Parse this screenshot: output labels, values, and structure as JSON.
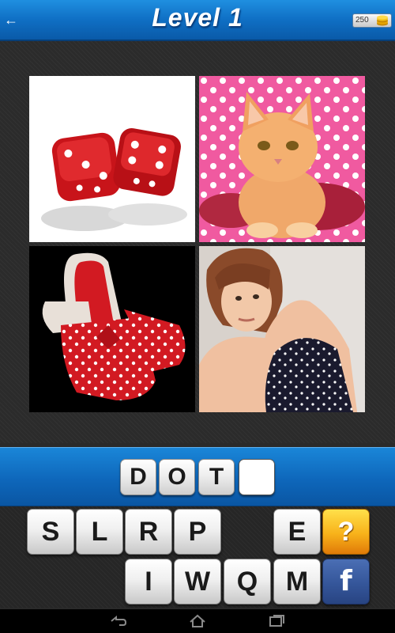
{
  "header": {
    "title": "Level 1",
    "back_icon": "back-arrow-icon",
    "coins": "250",
    "coin_icon": "coin-stack-icon"
  },
  "photos": [
    {
      "subject": "red dice"
    },
    {
      "subject": "orange kitten on pink polka-dot background"
    },
    {
      "subject": "red polka-dot slippers"
    },
    {
      "subject": "woman in polka-dot dress"
    }
  ],
  "answer": {
    "letters": [
      "D",
      "O",
      "T",
      ""
    ]
  },
  "keyboard": {
    "row1": [
      "S",
      "L",
      "R",
      "P",
      "E"
    ],
    "row2": [
      "I",
      "W",
      "Q",
      "M"
    ],
    "hint_label": "?",
    "facebook_label": "f"
  },
  "colors": {
    "header_blue": "#0f6fc4",
    "hint_orange": "#f8b21a",
    "facebook_blue": "#35569a"
  },
  "nav": {
    "back_icon": "nav-back-icon",
    "home_icon": "nav-home-icon",
    "recents_icon": "nav-recents-icon"
  }
}
